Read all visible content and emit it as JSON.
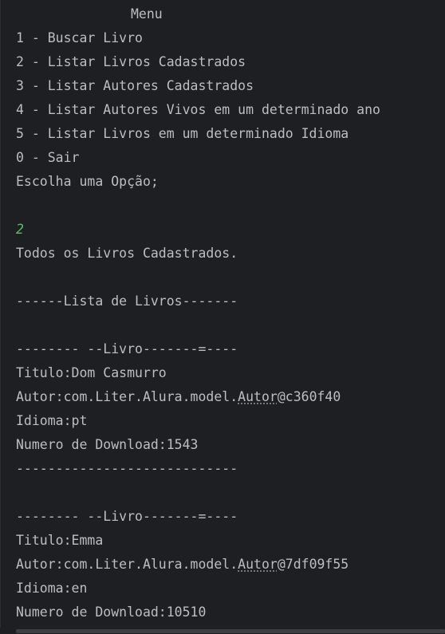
{
  "console": {
    "menu_title": "Menu",
    "menu_items": [
      "1 - Buscar Livro",
      "2 - Listar Livros Cadastrados",
      "3 - Listar Autores Cadastrados",
      "4 - Listar Autores Vivos em um determinado ano",
      "5 - Listar Livros em um determinado Idioma",
      "0 - Sair"
    ],
    "prompt": "Escolha uma Opção;",
    "user_input": "2",
    "result_heading": "Todos os Livros Cadastrados.",
    "list_header": "------Lista de Livros-------",
    "books": [
      {
        "separator_top": "-------- --Livro-------=----",
        "titulo": "Titulo:Dom Casmurro",
        "autor_prefix": "Autor:com.Liter.Alura.model.",
        "autor_class": "Autor",
        "autor_hash": "@c360f40",
        "idioma": "Idioma:pt",
        "downloads": "Numero de Download:1543",
        "separator_bottom": "----------------------------"
      },
      {
        "separator_top": "-------- --Livro-------=----",
        "titulo": "Titulo:Emma",
        "autor_prefix": "Autor:com.Liter.Alura.model.",
        "autor_class": "Autor",
        "autor_hash": "@7df09f55",
        "idioma": "Idioma:en",
        "downloads": "Numero de Download:10510"
      }
    ]
  },
  "colors": {
    "background": "#1e1f22",
    "text": "#bcbec4",
    "user_input": "#5fb96a"
  }
}
